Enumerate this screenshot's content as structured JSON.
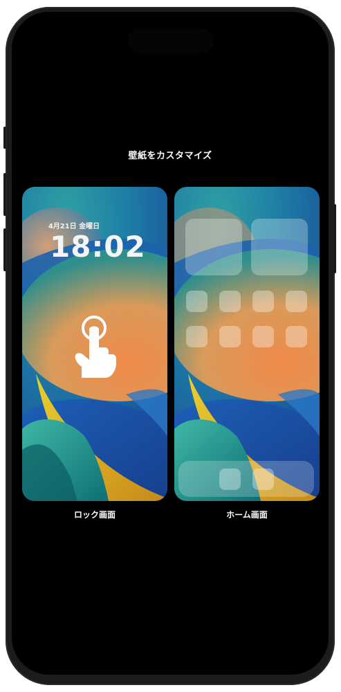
{
  "screen": {
    "title": "壁紙をカスタマイズ"
  },
  "lock_preview": {
    "date": "4月21日 金曜日",
    "time": "18:02",
    "caption": "ロック画面"
  },
  "home_preview": {
    "caption": "ホーム画面"
  },
  "colors": {
    "background": "#000000",
    "text": "#ffffff",
    "wallpaper_blue": "#1e5fb0",
    "wallpaper_teal": "#1f8a8c",
    "wallpaper_orange": "#e68a4e",
    "wallpaper_yellow": "#e6c02a"
  },
  "icons": {
    "tap_gesture": "hand-pointer-icon"
  }
}
